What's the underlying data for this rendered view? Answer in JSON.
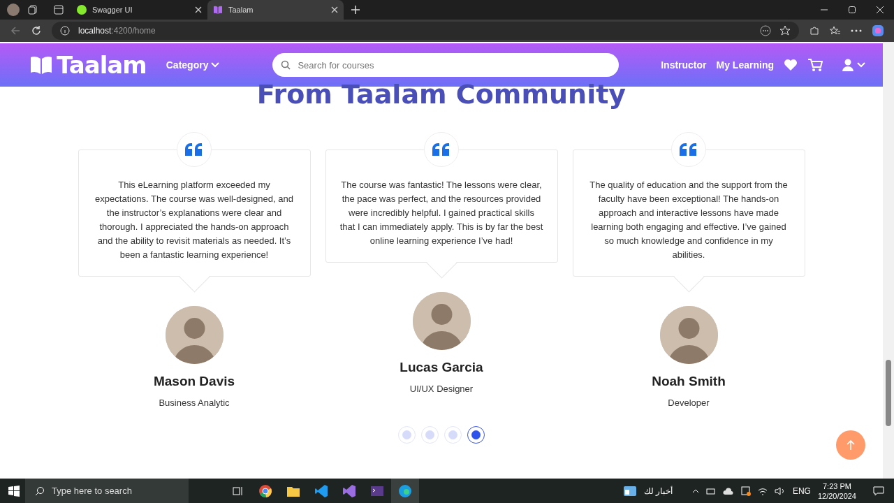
{
  "browser": {
    "tabs": [
      {
        "title": "Swagger UI",
        "selected": false
      },
      {
        "title": "Taalam",
        "selected": true
      }
    ],
    "address": {
      "host": "localhost",
      "rest": ":4200/home"
    }
  },
  "navbar": {
    "brand": "Taalam",
    "category": "Category",
    "search_placeholder": "Search for courses",
    "links": [
      "Instructor",
      "My Learning"
    ]
  },
  "section_title": "From Taalam Community",
  "testimonials": [
    {
      "quote": "This eLearning platform exceeded my expectations. The course was well-designed, and the instructor’s explanations were clear and thorough. I appreciated the hands-on approach and the ability to revisit materials as needed. It’s been a fantastic learning experience!",
      "name": "Mason Davis",
      "role": "Business Analytic"
    },
    {
      "quote": "The course was fantastic! The lessons were clear, the pace was perfect, and the resources provided were incredibly helpful. I gained practical skills that I can immediately apply. This is by far the best online learning experience I’ve had!",
      "name": "Lucas Garcia",
      "role": "UI/UX Designer"
    },
    {
      "quote": "The quality of education and the support from the faculty have been exceptional! The hands-on approach and interactive lessons have made learning both engaging and effective. I’ve gained so much knowledge and confidence in my abilities.",
      "name": "Noah Smith",
      "role": "Developer"
    }
  ],
  "carousel_dots": [
    {
      "selected": false
    },
    {
      "selected": false
    },
    {
      "selected": false
    },
    {
      "selected": true
    }
  ],
  "taskbar": {
    "search_placeholder": "Type here to search",
    "news": "أخبار لك",
    "language": "ENG",
    "time": "7:23 PM",
    "date": "12/20/2024"
  }
}
